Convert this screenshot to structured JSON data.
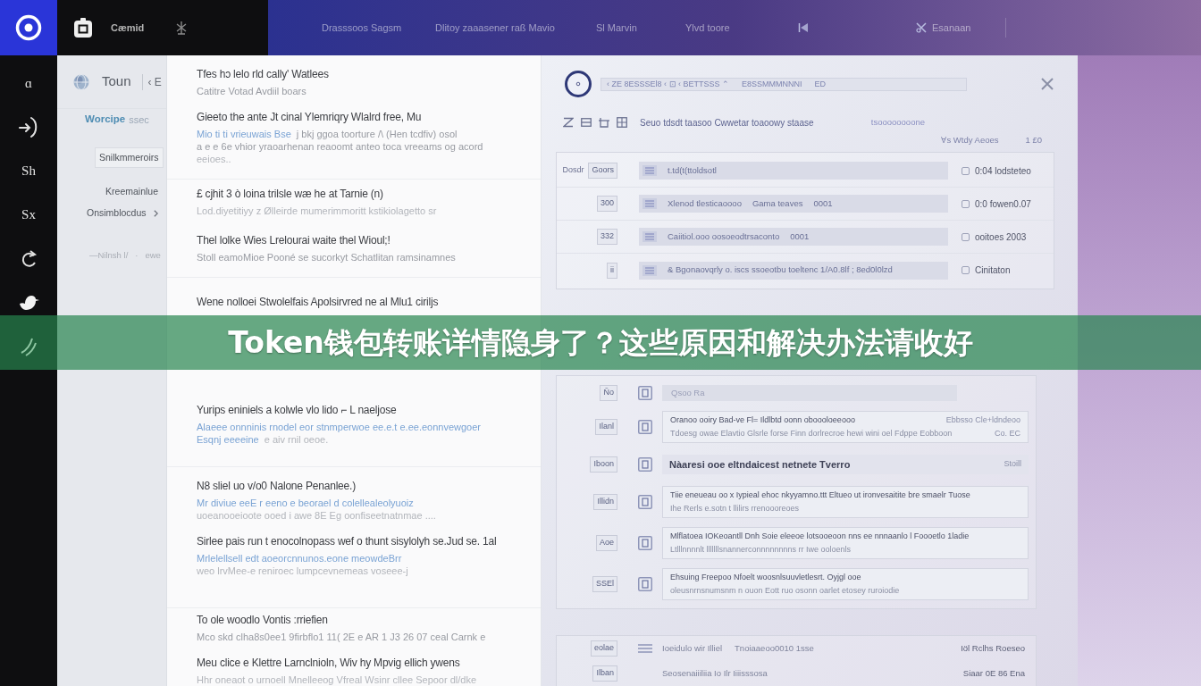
{
  "top_bar": {
    "brand": "Cæmid",
    "links": [
      "Drasssoos Sagsm",
      "Dlitoy zaaasener raß Mavio",
      "Sl Marvin",
      "Ylvd toore",
      "Esanaan"
    ]
  },
  "sidebar": {
    "items": [
      {
        "kind": "text",
        "label": "ɑ"
      },
      {
        "kind": "arrow"
      },
      {
        "kind": "text",
        "label": "Sh"
      },
      {
        "kind": "text",
        "label": "Sx"
      },
      {
        "kind": "cycle"
      },
      {
        "kind": "bird"
      },
      {
        "kind": "wave"
      }
    ]
  },
  "nav": {
    "title": "Toun",
    "back": "‹ E",
    "section": {
      "label": "Worcipe",
      "hint": "ssec"
    },
    "button": "Snilkmmeroirs",
    "items": [
      {
        "kind": "plain",
        "label": "Kreemainlue"
      },
      {
        "kind": "expandable",
        "label": "Onsimblocdus"
      }
    ],
    "footer": [
      "—Nilnsh l/",
      "·",
      "ewe"
    ]
  },
  "articles": [
    {
      "items": [
        {
          "title": "Tfes hɔ lelo rld cally'  Watlees",
          "lines": [
            [
              {
                "kind": "muted",
                "text": "Catitre Votad Avdiil boars"
              }
            ]
          ]
        },
        {
          "title": "Gieeto the ante Jt cinal Ylemriqry Wlalrd free, Mu",
          "lines": [
            [
              {
                "kind": "link",
                "text": "Mio ti ti vrieuwais Bse"
              },
              {
                "kind": "muted",
                "text": "j bkj ggoa toorture /\\ (Hen tcdfiv) osol"
              }
            ],
            [
              {
                "kind": "muted",
                "text": "a e e 6e vhior yraoarhenan reaoomt anteo toca vreeams og acord"
              }
            ],
            [
              {
                "kind": "faint",
                "text": "eeioes.."
              }
            ]
          ]
        }
      ]
    },
    {
      "items": [
        {
          "title": "£ cjhit 3 ò loina trilsle wæ he at Tarnie (n)",
          "lines": [
            [
              {
                "kind": "faint",
                "text": "Lod.diyetitiyy z Ølleirde mumerimmoritt kstikiolagetto sr"
              }
            ]
          ]
        },
        {
          "title": "Thel lolke Wies Lrelourai waite thel Wioul;!",
          "lines": [
            [
              {
                "kind": "muted",
                "text": "Stoll eamoMioe Pooné se sucorkyt Schatlitan ramsinamnes"
              }
            ]
          ]
        }
      ]
    },
    {
      "items": [
        {
          "title": "Wene nolloei Stwolelfais Apolsirvred ne al Mlu1 ciriljs"
        },
        {
          "title": "Yurips eniniels a kolwle vlo lido ⌐ L naeljose",
          "lines": [
            [
              {
                "kind": "link",
                "text": "Alaeee onnninis rnodel eor stnmperwoe ee.e.t e.ee.eonnvewgoer"
              }
            ],
            [
              {
                "kind": "link",
                "text": "Esqnj eeeeine"
              },
              {
                "kind": "faint",
                "text": "e aiv rnil oeoe."
              }
            ]
          ]
        }
      ]
    },
    {
      "items": [
        {
          "title": "N8 sliel uo v/o0 Nalone Penanlee.)",
          "lines": [
            [
              {
                "kind": "link",
                "text": "Mr diviue eeE r eeno e beorael d colellealeolyuoiz"
              }
            ],
            [
              {
                "kind": "faint",
                "text": "uoeanooeioote ooed i awe 8E Eg oonfiseetnatnmae ...."
              }
            ]
          ]
        },
        {
          "title": "Sirlee pais run t enocolnopass wef o thunt sisylolyh se.Jud se. 1al",
          "lines": [
            [
              {
                "kind": "link",
                "text": "Mrlelellsell edt aoeorcnnunos.eone meowdeBrr"
              }
            ],
            [
              {
                "kind": "faint",
                "text": "weo lrvMee-e  reniroec  lumpcevnemeas  voseee-j"
              }
            ]
          ]
        }
      ]
    },
    {
      "items": [
        {
          "title": "To ole woodlo Vontis :rriefien",
          "lines": [
            [
              {
                "kind": "muted",
                "text": "Mco skd clha8s0ee1 9firbflo1 11( 2E e AR 1 J3 26 07 ceal Carnk e"
              }
            ]
          ]
        },
        {
          "title": "Meu clice e Klettre Larnclnioln, Wiv hy Mpvig ellich ywens",
          "lines": [
            [
              {
                "kind": "faint",
                "text": "Hhr oneaot o urnoell Mnelleeog Vfreal Wsinr cllee Sepoor dl/dke"
              }
            ]
          ]
        }
      ]
    }
  ],
  "panel": {
    "search": [
      "‹ ZE 8ESSSEl8 ‹ ⊡ ‹ BETTSSS ⌃",
      "E8SSMMMNNNI",
      "ED"
    ],
    "toolbar": {
      "text": "Seuo tdsdt taasoo Cwwetar toaoowy staase",
      "right": "tsoooooooone",
      "filter": "Ɐs Wtdy Aeoes",
      "count": "1 £0"
    },
    "rows": [
      {
        "labels": [
          "Dosdr",
          "Goors"
        ],
        "texts": [
          "t.td(t(ttoldsotl"
        ],
        "aside": "0:04 lodsteteo"
      },
      {
        "labels": [
          "300"
        ],
        "texts": [
          "Xlenod tlesticaoooo",
          "Gama teaves",
          "0001"
        ],
        "aside": "0:0 fowen0.07"
      },
      {
        "labels": [
          "332"
        ],
        "texts": [
          "Caiitiol.ooo oosoeodtrsaconto",
          "0001"
        ],
        "aside": "ooitoes 2003"
      },
      {
        "labels": [
          "ii"
        ],
        "texts": [
          "& Bgonaovqrly o. iscs ssoeotbu toeltenc 1/A0.8lf ; 8ed0l0lzd"
        ],
        "aside": "Cinitaton"
      }
    ],
    "entries": [
      {
        "kind": "bar",
        "label": "Ño",
        "lines": [
          "Qsoo Ra"
        ]
      },
      {
        "kind": "card",
        "label": "Ilanl",
        "lines": [
          "Oranoo ooiry Bad-ve  Fl= Ildlbtd oonn oboooloeeooo",
          "Tdoesg owae Elavtio Glsrle forse Finn dorlrecroe hewi wini oel Fdppe Eobboon"
        ],
        "aside": [
          "Ebbsso Cle+ldndeoo",
          "Co. EC"
        ]
      },
      {
        "kind": "heading",
        "label": "Iboon",
        "lines": [
          "Nàaresi ooe eltndaicest netnete Tverro"
        ],
        "aside": [
          "Stoill"
        ]
      },
      {
        "kind": "card",
        "label": "Illidn",
        "lines": [
          "Tiie eneueau oo x Iypieal ehoc nkyyamno.ttt Eltueo ut ironvesaitite bre smaelr Tuose",
          "Ihe Rerls e.sotn t llilirs rrenoooreoes"
        ]
      },
      {
        "kind": "card",
        "label": "Aoe",
        "lines": [
          "Mlflatoea IOKeoantll Dnh Soie eleeoe lotsooeoon nns ee  nnnaanlo l Foooetlo 1ladie",
          "Ltlllnnnnlt lllllllsnannerconnnnnnnns rr Iwe ooloenls"
        ]
      },
      {
        "kind": "card",
        "label": "SSEl",
        "lines": [
          "Ehsuing Freepoo Nfoelt woosnlsuuvletlesrt. Oyjgl ooe",
          "oleusnrnsnumsnm n ouon Eott ruo osonn oarlet etosey ruroiodie"
        ]
      }
    ],
    "footer_rows": [
      {
        "kind": "menu",
        "label": "eolae",
        "texts": [
          "Ioeidulo wir Illiel",
          "Tnoiaaeoo0010 1sse"
        ],
        "aside": "Iöl Rclhs Roeseo"
      },
      {
        "kind": "plain",
        "label": "Ilban",
        "texts": [
          "Seosenaiiiliia Io Ilr Iiiisssosa"
        ],
        "aside": "Siaar 0E 86 Ena"
      }
    ]
  },
  "banner": {
    "title": "Token钱包转账详情隐身了？这些原因和解决办法请收好"
  }
}
